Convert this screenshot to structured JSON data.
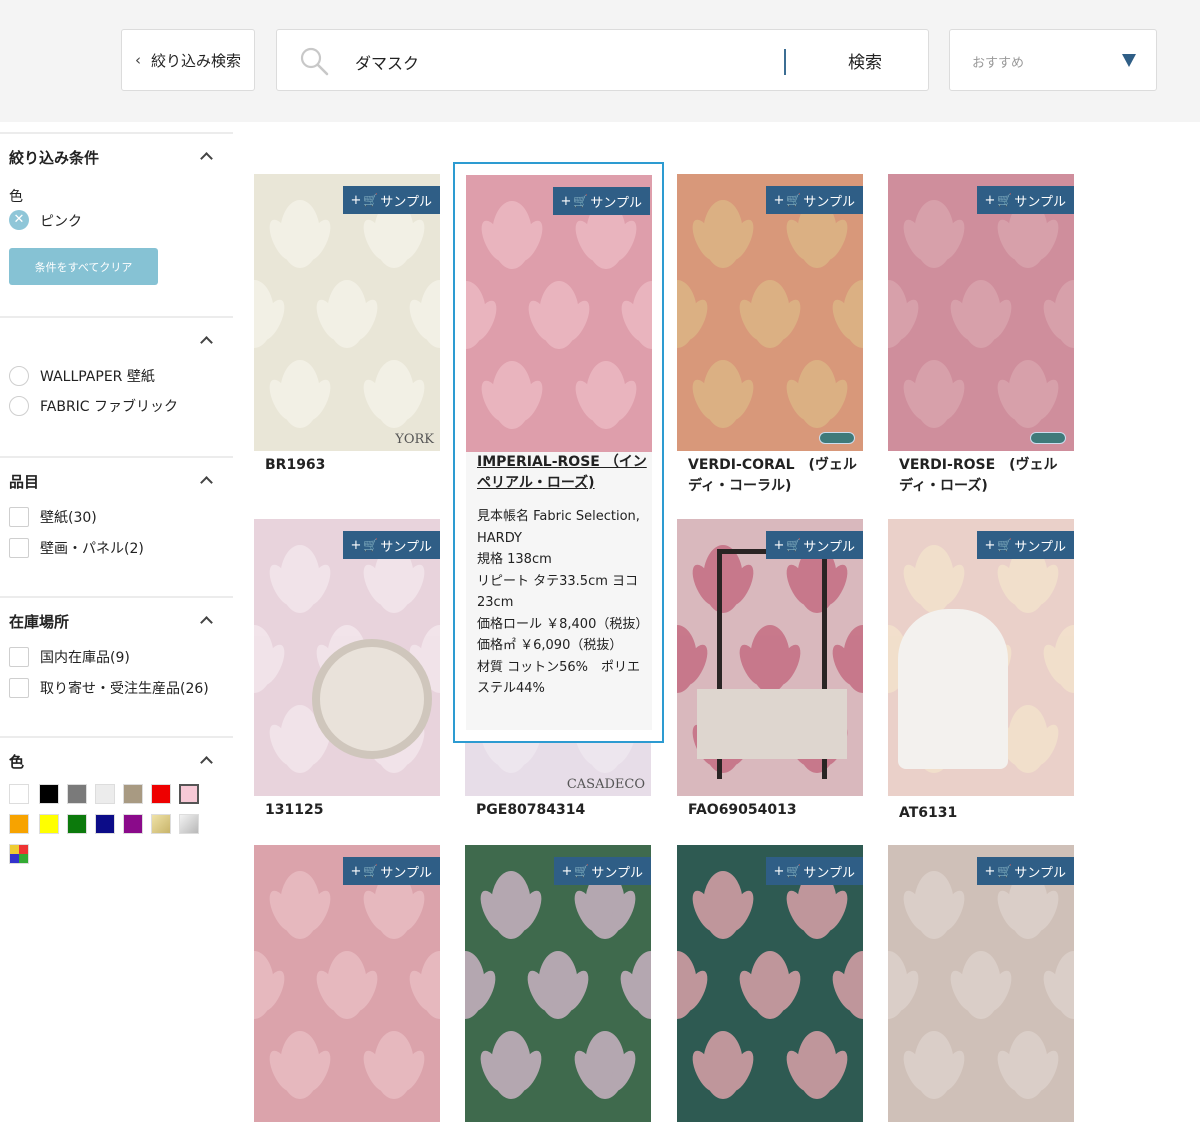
{
  "topbar": {
    "filter_button": "絞り込み検索",
    "search_query": "ダマスク",
    "search_button": "検索",
    "sort_value": "おすすめ"
  },
  "sidebar": {
    "conditions": {
      "heading": "絞り込み条件",
      "sub_label": "色",
      "active_filter": "ピンク",
      "clear_button": "条件をすべてクリア"
    },
    "category": {
      "options": [
        "WALLPAPER 壁紙",
        "FABRIC ファブリック"
      ]
    },
    "item_type": {
      "heading": "品目",
      "options": [
        "壁紙(30)",
        "壁画・パネル(2)"
      ]
    },
    "stock": {
      "heading": "在庫場所",
      "options": [
        "国内在庫品(9)",
        "取り寄せ・受注生産品(26)"
      ]
    },
    "color": {
      "heading": "色",
      "swatches": [
        "#ffffff",
        "#000000",
        "#7a7a7a",
        "#ececec",
        "#a89a82",
        "#ee0000",
        "#f7c9d6",
        "#f7a300",
        "#ffff00",
        "#0c7a0c",
        "#0c0c88",
        "#8a0a8a",
        "#d8cc8c",
        "#cfcfcf",
        "multi"
      ],
      "selected": "#f7c9d6"
    }
  },
  "sample_label": "サンプル",
  "products": [
    {
      "name": "BR1963",
      "brand": "YORK",
      "bg": "#e9e6d7",
      "pattern": "#f4f2e8"
    },
    {
      "name": "IMPERIAL-ROSE （インペリアル・ローズ)",
      "bg": "#de9eab",
      "pattern": "#ecb9c2"
    },
    {
      "name": "VERDI-CORAL　(ヴェルディ・コーラル)",
      "bg": "#d8987a",
      "pattern": "#dcb585"
    },
    {
      "name": "VERDI-ROSE　(ヴェルディ・ローズ)",
      "bg": "#cf8e9c",
      "pattern": "#d9a4ad"
    },
    {
      "name": "131125",
      "bg": "#e8d3dc",
      "pattern": "#f3e6ec"
    },
    {
      "name": "PGE80784314",
      "brand": "CASADECO",
      "bg": "#e7dde8",
      "pattern": "#efe8f0"
    },
    {
      "name": "FAO69054013",
      "bg": "#d9b8bd",
      "pattern": "#c46d83"
    },
    {
      "name": "AT6131",
      "bg": "#ead0c9",
      "pattern": "#f3e2cc"
    },
    {
      "name": "",
      "bg": "#dba3ab",
      "pattern": "#e8bcc2"
    },
    {
      "name": "",
      "bg": "#3f6a4d",
      "pattern": "#c9b2c2"
    },
    {
      "name": "",
      "bg": "#2e5a52",
      "pattern": "#d9a1a8"
    },
    {
      "name": "",
      "bg": "#cfc0b8",
      "pattern": "#ddd1cb"
    }
  ],
  "hover_detail": {
    "title": "IMPERIAL-ROSE （インペリアル・ローズ)",
    "lines": [
      "見本帳名 Fabric Selection, HARDY",
      "規格 138cm",
      "リピート タテ33.5cm ヨコ23cm",
      "価格ロール ￥8,400（税抜）",
      "価格㎡ ￥6,090（税抜）",
      "材質 コットン56%　ポリエステル44%"
    ]
  }
}
